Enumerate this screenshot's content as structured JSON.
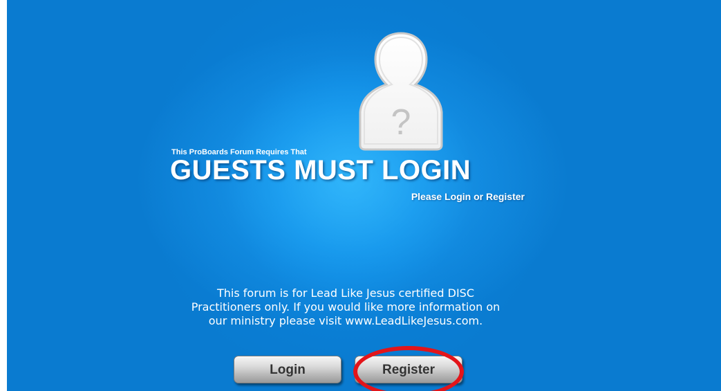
{
  "header": {
    "pre_title": "This ProBoards Forum Requires That",
    "title": "GUESTS MUST LOGIN",
    "post_title": "Please Login or Register"
  },
  "avatar": {
    "icon": "guest-user-icon",
    "glyph": "?"
  },
  "info": {
    "lines": [
      "This forum is for Lead Like Jesus certified DISC",
      "Practitioners only. If you would like more information on",
      "our ministry please visit www.LeadLikeJesus.com."
    ]
  },
  "buttons": {
    "login_label": "Login",
    "register_label": "Register"
  },
  "annotation": {
    "color": "#e3151a",
    "target": "register-button"
  },
  "colors": {
    "background": "#0a7fd6",
    "glow": "#22aaf5",
    "text": "#ffffff",
    "button_text": "#333333"
  }
}
